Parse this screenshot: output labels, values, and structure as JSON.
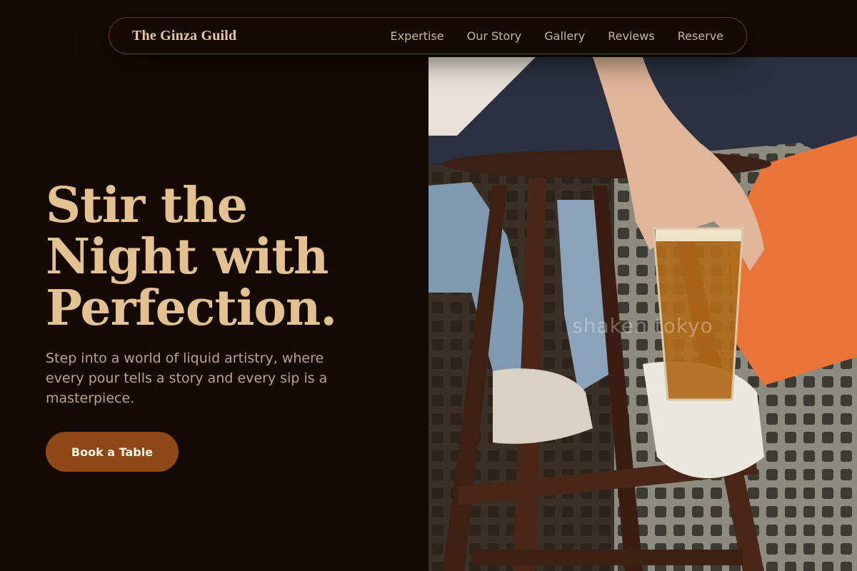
{
  "nav": {
    "brand": "The Ginza Guild",
    "links": [
      "Expertise",
      "Our Story",
      "Gallery",
      "Reviews",
      "Reserve"
    ]
  },
  "hero": {
    "title": "Stir the Night with Perfection.",
    "subtitle": "Step into a world of liquid artistry, where every pour tells a story and every sip is a masterpiece.",
    "cta_label": "Book a Table"
  },
  "photo": {
    "watermark": "shaken tokyo"
  },
  "colors": {
    "background": "#140a03",
    "accent": "#8e4716",
    "heading": "#e3c190",
    "nav_border": "#6b3a1f"
  }
}
